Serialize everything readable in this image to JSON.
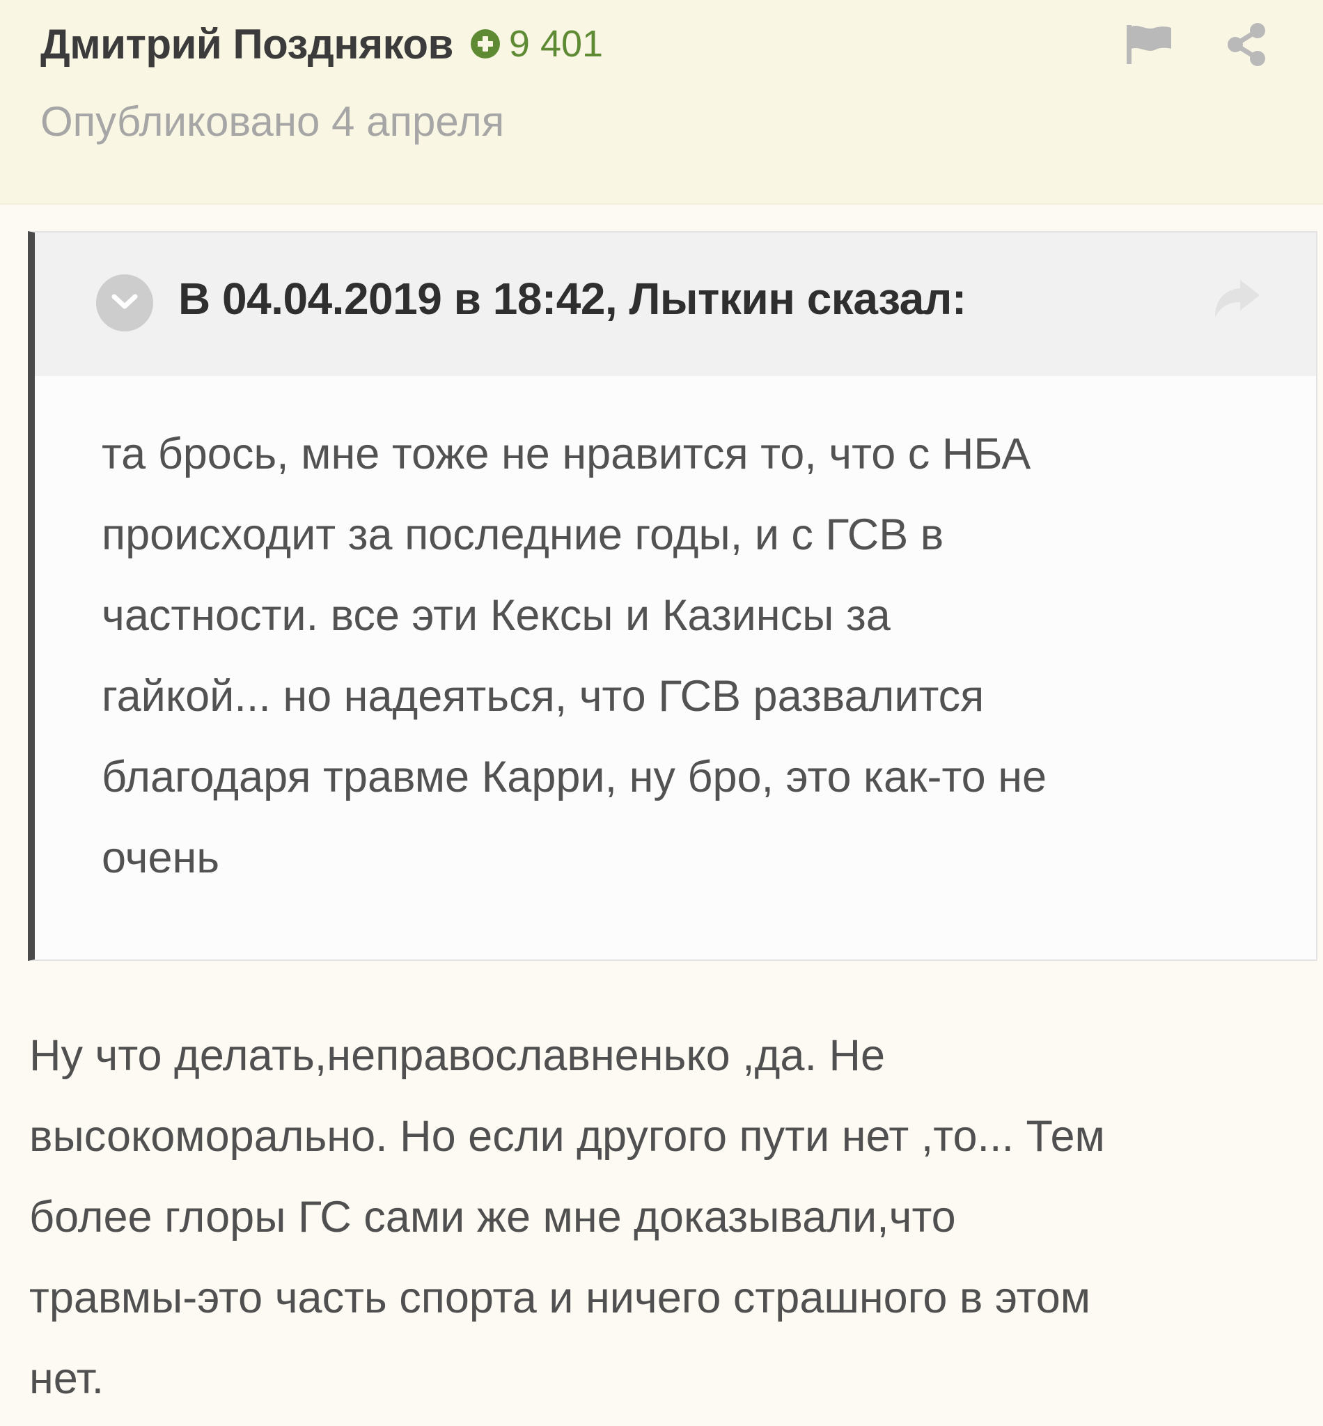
{
  "post": {
    "author": {
      "name": "Дмитрий Поздняков",
      "reputation": "9 401",
      "reputation_icon": "plus-circle-icon"
    },
    "published": "Опубликовано 4 апреля",
    "actions": {
      "report_icon": "flag-icon",
      "share_icon": "share-icon"
    },
    "quote": {
      "toggle_icon": "chevron-down-icon",
      "citation": "В 04.04.2019 в 18:42, Лыткин сказал:",
      "jump_icon": "reply-arrow-icon",
      "lines": [
        "та брось, мне тоже не нравится то, что с НБА",
        "происходит за последние годы, и с ГСВ в",
        "частности. все эти Кексы и Казинсы за",
        "гайкой... но надеяться, что ГСВ развалится",
        "благодаря травме Карри, ну бро, это как-то не",
        "очень"
      ]
    },
    "body": {
      "lines": [
        "Ну что делать,неправославненько ,да. Не",
        "высокоморально. Но если другого пути нет ,то... Тем",
        "более глоры ГС сами же мне доказывали,что",
        "травмы-это часть спорта и ничего страшного в этом",
        "нет."
      ]
    },
    "colors": {
      "header_background": "#faf6e4",
      "page_background": "#fcfaf3",
      "reputation_green": "#5d8a32",
      "quote_border": "#4a4a4a",
      "quote_header_background": "#f1f1f1"
    }
  }
}
